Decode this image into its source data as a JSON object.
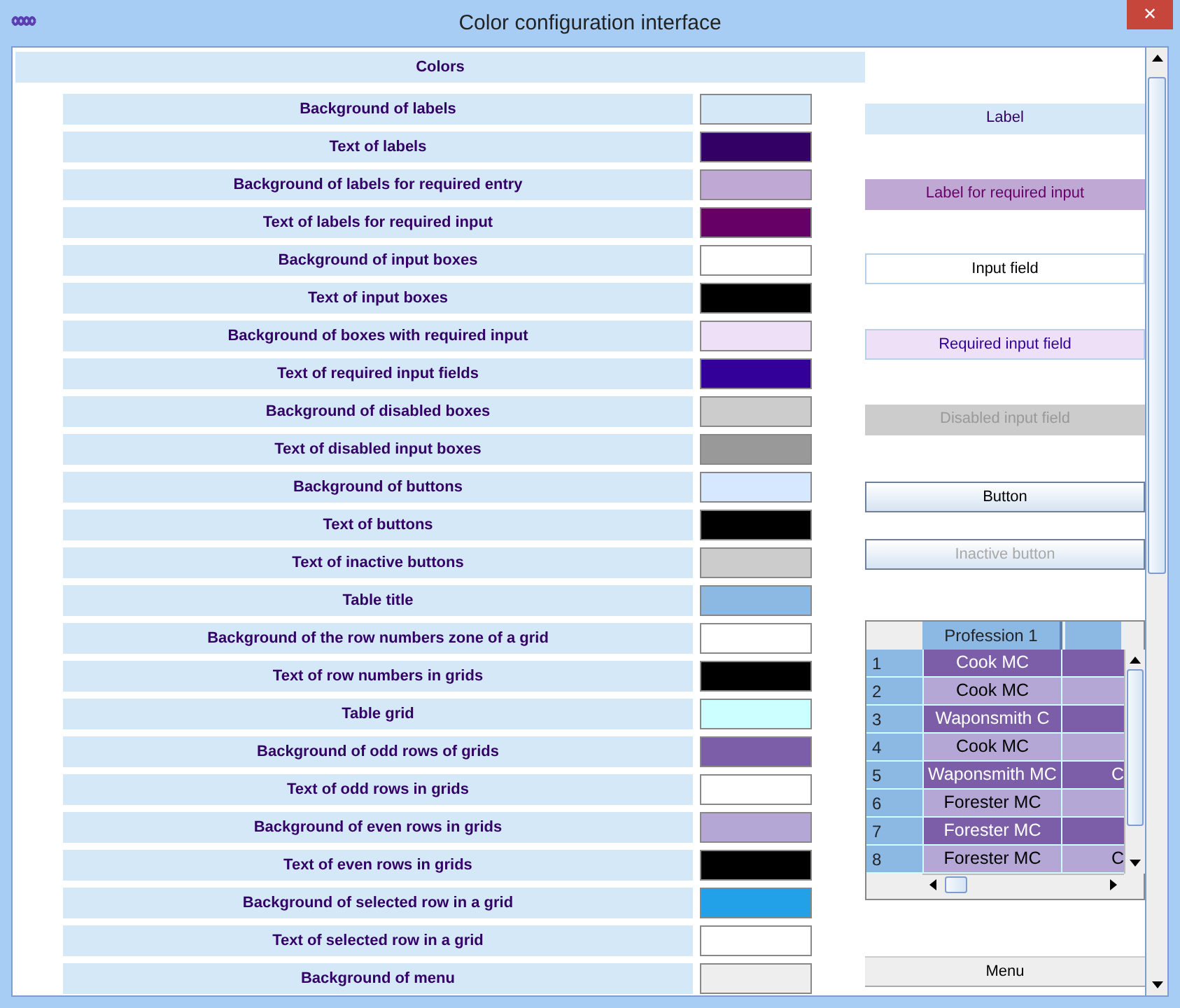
{
  "window": {
    "title": "Color configuration interface",
    "close": "✕"
  },
  "colors_header": "Colors",
  "colors": [
    {
      "label": "Background of labels",
      "color": "#d4e8f7"
    },
    {
      "label": "Text of labels",
      "color": "#330066"
    },
    {
      "label": "Background of labels for required entry",
      "color": "#c0a8d4"
    },
    {
      "label": "Text of labels for required input",
      "color": "#660066"
    },
    {
      "label": "Background of input boxes",
      "color": "#ffffff"
    },
    {
      "label": "Text of input boxes",
      "color": "#000000"
    },
    {
      "label": "Background of boxes with required input",
      "color": "#eee0f7"
    },
    {
      "label": "Text of required input fields",
      "color": "#330099"
    },
    {
      "label": "Background of disabled boxes",
      "color": "#cccccc"
    },
    {
      "label": "Text of disabled input boxes",
      "color": "#999999"
    },
    {
      "label": "Background of buttons",
      "color": "#d6e8ff"
    },
    {
      "label": "Text of buttons",
      "color": "#000000"
    },
    {
      "label": "Text of inactive buttons",
      "color": "#cccccc"
    },
    {
      "label": "Table title",
      "color": "#8cb8e4"
    },
    {
      "label": "Background of the row numbers zone of a grid",
      "color": "#ffffff"
    },
    {
      "label": "Text of row numbers in grids",
      "color": "#000000"
    },
    {
      "label": "Table grid",
      "color": "#ccffff"
    },
    {
      "label": "Background of odd rows of grids",
      "color": "#7b5ea7"
    },
    {
      "label": "Text of odd rows in grids",
      "color": "#ffffff"
    },
    {
      "label": "Background of even rows in grids",
      "color": "#b4a7d6"
    },
    {
      "label": "Text of even rows in grids",
      "color": "#000000"
    },
    {
      "label": "Background of selected row in a grid",
      "color": "#22a0e8"
    },
    {
      "label": "Text of selected row in a grid",
      "color": "#ffffff"
    },
    {
      "label": "Background of menu",
      "color": "#eeeeee"
    }
  ],
  "preview": [
    {
      "kind": "label",
      "text": "Label"
    },
    {
      "kind": "required-label",
      "text": "Label for required input"
    },
    {
      "kind": "input",
      "text": "Input field"
    },
    {
      "kind": "required-input",
      "text": "Required input field"
    },
    {
      "kind": "disabled-input",
      "text": "Disabled input field"
    },
    {
      "kind": "button",
      "text": "Button"
    },
    {
      "kind": "inactive-button",
      "text": "Inactive button"
    }
  ],
  "grid": {
    "header": "Profession 1",
    "rows": [
      {
        "number": "1",
        "cell": "Cook  MC"
      },
      {
        "number": "2",
        "cell": "Cook  MC"
      },
      {
        "number": "3",
        "cell": "Waponsmith C"
      },
      {
        "number": "4",
        "cell": "Cook MC"
      },
      {
        "number": "5",
        "cell": "Waponsmith MC",
        "cell_2": "C"
      },
      {
        "number": "6",
        "cell": "Forester  MC"
      },
      {
        "number": "7",
        "cell": "Forester  MC"
      },
      {
        "number": "8",
        "cell": "Forester MC",
        "cell_2": "C"
      }
    ]
  },
  "menu": "Menu"
}
